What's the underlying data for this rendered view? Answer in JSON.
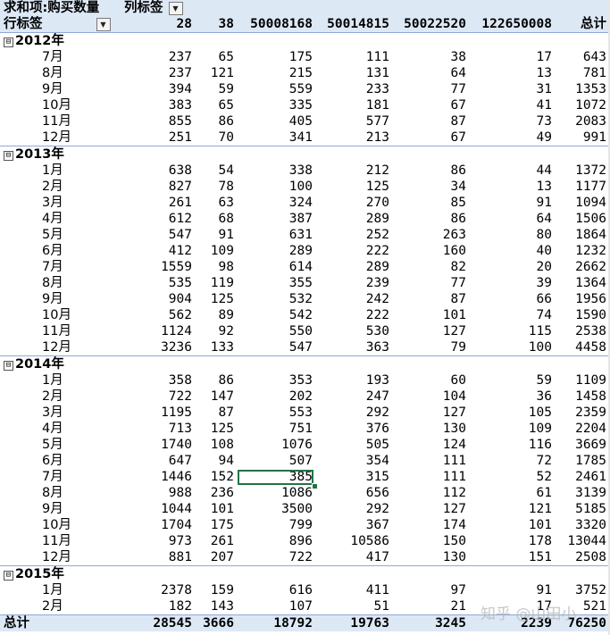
{
  "header": {
    "value_field": "求和项:购买数量",
    "column_label": "列标签",
    "row_label": "行标签",
    "columns": [
      "28",
      "38",
      "50008168",
      "50014815",
      "50022520",
      "122650008",
      "总计"
    ]
  },
  "groups": [
    {
      "year": "2012年",
      "toggle": "⊟",
      "rows": [
        {
          "month": "7月",
          "values": [
            "237",
            "65",
            "175",
            "111",
            "38",
            "17",
            "643"
          ]
        },
        {
          "month": "8月",
          "values": [
            "237",
            "121",
            "215",
            "131",
            "64",
            "13",
            "781"
          ]
        },
        {
          "month": "9月",
          "values": [
            "394",
            "59",
            "559",
            "233",
            "77",
            "31",
            "1353"
          ]
        },
        {
          "month": "10月",
          "values": [
            "383",
            "65",
            "335",
            "181",
            "67",
            "41",
            "1072"
          ]
        },
        {
          "month": "11月",
          "values": [
            "855",
            "86",
            "405",
            "577",
            "87",
            "73",
            "2083"
          ]
        },
        {
          "month": "12月",
          "values": [
            "251",
            "70",
            "341",
            "213",
            "67",
            "49",
            "991"
          ]
        }
      ]
    },
    {
      "year": "2013年",
      "toggle": "⊟",
      "rows": [
        {
          "month": "1月",
          "values": [
            "638",
            "54",
            "338",
            "212",
            "86",
            "44",
            "1372"
          ]
        },
        {
          "month": "2月",
          "values": [
            "827",
            "78",
            "100",
            "125",
            "34",
            "13",
            "1177"
          ]
        },
        {
          "month": "3月",
          "values": [
            "261",
            "63",
            "324",
            "270",
            "85",
            "91",
            "1094"
          ]
        },
        {
          "month": "4月",
          "values": [
            "612",
            "68",
            "387",
            "289",
            "86",
            "64",
            "1506"
          ]
        },
        {
          "month": "5月",
          "values": [
            "547",
            "91",
            "631",
            "252",
            "263",
            "80",
            "1864"
          ]
        },
        {
          "month": "6月",
          "values": [
            "412",
            "109",
            "289",
            "222",
            "160",
            "40",
            "1232"
          ]
        },
        {
          "month": "7月",
          "values": [
            "1559",
            "98",
            "614",
            "289",
            "82",
            "20",
            "2662"
          ]
        },
        {
          "month": "8月",
          "values": [
            "535",
            "119",
            "355",
            "239",
            "77",
            "39",
            "1364"
          ]
        },
        {
          "month": "9月",
          "values": [
            "904",
            "125",
            "532",
            "242",
            "87",
            "66",
            "1956"
          ]
        },
        {
          "month": "10月",
          "values": [
            "562",
            "89",
            "542",
            "222",
            "101",
            "74",
            "1590"
          ]
        },
        {
          "month": "11月",
          "values": [
            "1124",
            "92",
            "550",
            "530",
            "127",
            "115",
            "2538"
          ]
        },
        {
          "month": "12月",
          "values": [
            "3236",
            "133",
            "547",
            "363",
            "79",
            "100",
            "4458"
          ]
        }
      ]
    },
    {
      "year": "2014年",
      "toggle": "⊟",
      "rows": [
        {
          "month": "1月",
          "values": [
            "358",
            "86",
            "353",
            "193",
            "60",
            "59",
            "1109"
          ]
        },
        {
          "month": "2月",
          "values": [
            "722",
            "147",
            "202",
            "247",
            "104",
            "36",
            "1458"
          ]
        },
        {
          "month": "3月",
          "values": [
            "1195",
            "87",
            "553",
            "292",
            "127",
            "105",
            "2359"
          ]
        },
        {
          "month": "4月",
          "values": [
            "713",
            "125",
            "751",
            "376",
            "130",
            "109",
            "2204"
          ]
        },
        {
          "month": "5月",
          "values": [
            "1740",
            "108",
            "1076",
            "505",
            "124",
            "116",
            "3669"
          ]
        },
        {
          "month": "6月",
          "values": [
            "647",
            "94",
            "507",
            "354",
            "111",
            "72",
            "1785"
          ]
        },
        {
          "month": "7月",
          "values": [
            "1446",
            "152",
            "385",
            "315",
            "111",
            "52",
            "2461"
          ]
        },
        {
          "month": "8月",
          "values": [
            "988",
            "236",
            "1086",
            "656",
            "112",
            "61",
            "3139"
          ]
        },
        {
          "month": "9月",
          "values": [
            "1044",
            "101",
            "3500",
            "292",
            "127",
            "121",
            "5185"
          ]
        },
        {
          "month": "10月",
          "values": [
            "1704",
            "175",
            "799",
            "367",
            "174",
            "101",
            "3320"
          ]
        },
        {
          "month": "11月",
          "values": [
            "973",
            "261",
            "896",
            "10586",
            "150",
            "178",
            "13044"
          ]
        },
        {
          "month": "12月",
          "values": [
            "881",
            "207",
            "722",
            "417",
            "130",
            "151",
            "2508"
          ]
        }
      ]
    },
    {
      "year": "2015年",
      "toggle": "⊟",
      "rows": [
        {
          "month": "1月",
          "values": [
            "2378",
            "159",
            "616",
            "411",
            "97",
            "91",
            "3752"
          ]
        },
        {
          "month": "2月",
          "values": [
            "182",
            "143",
            "107",
            "51",
            "21",
            "17",
            "521"
          ]
        }
      ]
    }
  ],
  "total": {
    "label": "总计",
    "values": [
      "28545",
      "3666",
      "18792",
      "19763",
      "3245",
      "2239",
      "76250"
    ]
  },
  "selection": {
    "cell_value": "385",
    "border_color": "#217346"
  },
  "watermark": "知乎 @山田小"
}
